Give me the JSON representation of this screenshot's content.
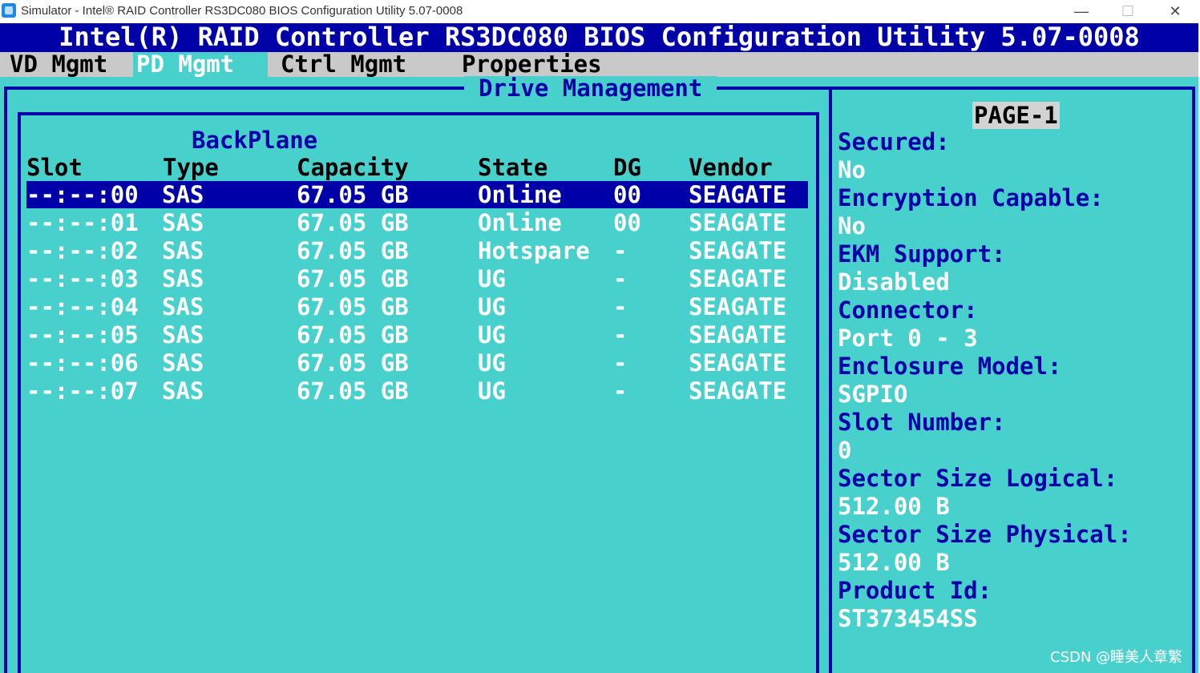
{
  "window": {
    "title": "Simulator - Intel® RAID Controller RS3DC080 BIOS Configuration Utility 5.07-0008",
    "minimize_glyph": "—",
    "maximize_glyph": "☐",
    "close_glyph": "✕"
  },
  "banner": {
    "title": "Intel(R) RAID Controller RS3DC080 BIOS Configuration Utility 5.07-0008"
  },
  "menu": {
    "items": [
      {
        "label": "VD Mgmt"
      },
      {
        "label": "PD Mgmt"
      },
      {
        "label": "Ctrl Mgmt"
      },
      {
        "label": "Properties"
      }
    ],
    "active_index": 1
  },
  "panel": {
    "title": "Drive Management",
    "subtitle": "BackPlane",
    "headers": [
      "Slot",
      "Type",
      "Capacity",
      "State",
      "DG",
      "Vendor"
    ],
    "rows": [
      {
        "slot": "--:--:00",
        "type": "SAS",
        "capacity": "67.05 GB",
        "state": "Online",
        "dg": "00",
        "vendor": "SEAGATE",
        "selected": true
      },
      {
        "slot": "--:--:01",
        "type": "SAS",
        "capacity": "67.05 GB",
        "state": "Online",
        "dg": "00",
        "vendor": "SEAGATE"
      },
      {
        "slot": "--:--:02",
        "type": "SAS",
        "capacity": "67.05 GB",
        "state": "Hotspare",
        "dg": "-",
        "vendor": "SEAGATE"
      },
      {
        "slot": "--:--:03",
        "type": "SAS",
        "capacity": "67.05 GB",
        "state": "UG",
        "dg": "-",
        "vendor": "SEAGATE"
      },
      {
        "slot": "--:--:04",
        "type": "SAS",
        "capacity": "67.05 GB",
        "state": "UG",
        "dg": "-",
        "vendor": "SEAGATE"
      },
      {
        "slot": "--:--:05",
        "type": "SAS",
        "capacity": "67.05 GB",
        "state": "UG",
        "dg": "-",
        "vendor": "SEAGATE"
      },
      {
        "slot": "--:--:06",
        "type": "SAS",
        "capacity": "67.05 GB",
        "state": "UG",
        "dg": "-",
        "vendor": "SEAGATE"
      },
      {
        "slot": "--:--:07",
        "type": "SAS",
        "capacity": "67.05 GB",
        "state": "UG",
        "dg": "-",
        "vendor": "SEAGATE"
      }
    ]
  },
  "sidebar": {
    "page_label": "PAGE-1",
    "lines": [
      {
        "text": "Secured:",
        "kind": "label"
      },
      {
        "text": "No",
        "kind": "value"
      },
      {
        "text": "Encryption Capable:",
        "kind": "label"
      },
      {
        "text": "No",
        "kind": "value"
      },
      {
        "text": "EKM Support:",
        "kind": "label"
      },
      {
        "text": "Disabled",
        "kind": "value"
      },
      {
        "text": "Connector:",
        "kind": "label"
      },
      {
        "text": "Port 0 - 3",
        "kind": "value"
      },
      {
        "text": "Enclosure Model:",
        "kind": "label"
      },
      {
        "text": "SGPIO",
        "kind": "value"
      },
      {
        "text": "Slot Number:",
        "kind": "label"
      },
      {
        "text": "0",
        "kind": "value"
      },
      {
        "text": "Sector Size Logical:",
        "kind": "label"
      },
      {
        "text": "512.00 B",
        "kind": "value"
      },
      {
        "text": "Sector Size Physical:",
        "kind": "label"
      },
      {
        "text": "512.00 B",
        "kind": "value"
      },
      {
        "text": "Product Id:",
        "kind": "label"
      },
      {
        "text": "ST373454SS",
        "kind": "value"
      }
    ]
  },
  "watermark": "CSDN @睡美人章繁",
  "colors": {
    "screen_bg": "#48d1cc",
    "bios_blue": "#0000a8",
    "menubar_gray": "#c9c9c9",
    "text_white": "#ffffff"
  }
}
